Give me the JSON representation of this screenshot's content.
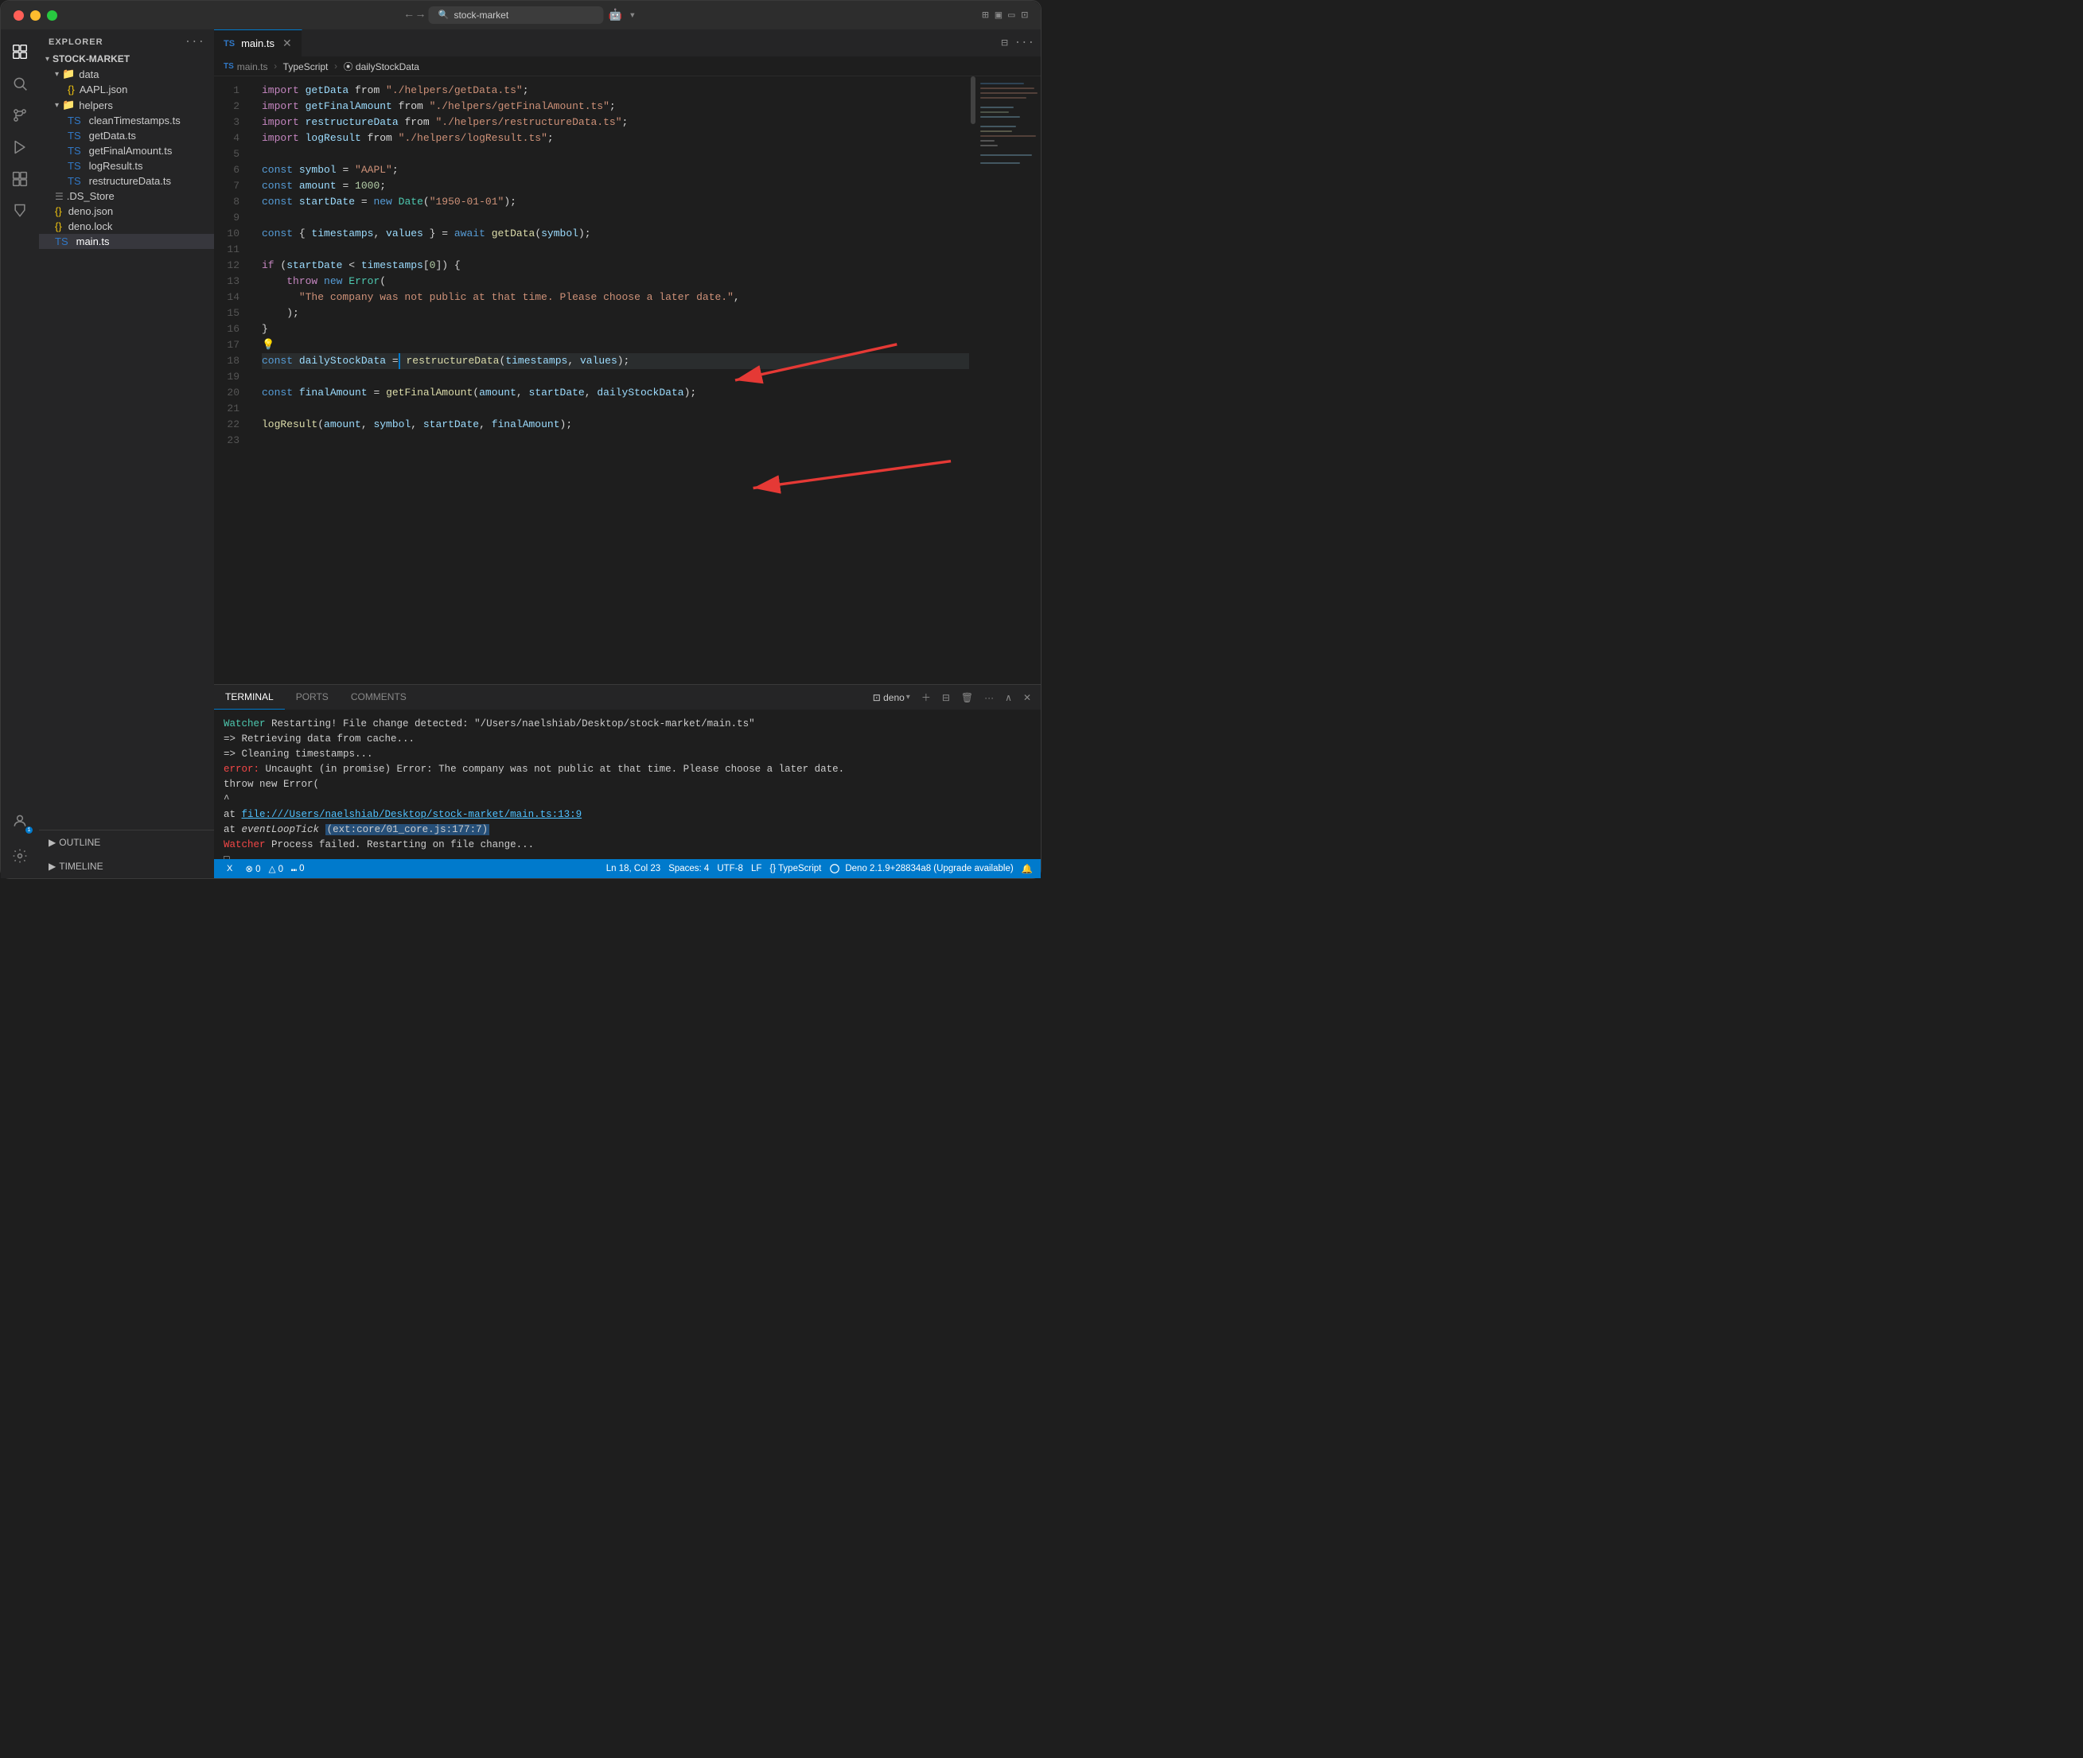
{
  "titlebar": {
    "search_placeholder": "stock-market",
    "nav_back": "←",
    "nav_forward": "→"
  },
  "activity_bar": {
    "items": [
      {
        "name": "explorer",
        "icon": "⧉",
        "active": true
      },
      {
        "name": "search",
        "icon": "🔍"
      },
      {
        "name": "source-control",
        "icon": "⑂"
      },
      {
        "name": "run-debug",
        "icon": "▷"
      },
      {
        "name": "extensions",
        "icon": "⊞"
      },
      {
        "name": "testing",
        "icon": "⚗"
      }
    ]
  },
  "sidebar": {
    "title": "EXPLORER",
    "more_icon": "···",
    "project_name": "STOCK-MARKET",
    "tree": [
      {
        "level": 1,
        "type": "folder",
        "name": "data",
        "expanded": true
      },
      {
        "level": 2,
        "type": "json",
        "name": "AAPL.json"
      },
      {
        "level": 1,
        "type": "folder",
        "name": "helpers",
        "expanded": true
      },
      {
        "level": 2,
        "type": "ts",
        "name": "cleanTimestamps.ts"
      },
      {
        "level": 2,
        "type": "ts",
        "name": "getData.ts"
      },
      {
        "level": 2,
        "type": "ts",
        "name": "getFinalAmount.ts"
      },
      {
        "level": 2,
        "type": "ts",
        "name": "logResult.ts"
      },
      {
        "level": 2,
        "type": "ts",
        "name": "restructureData.ts"
      },
      {
        "level": 1,
        "type": "file",
        "name": ".DS_Store"
      },
      {
        "level": 1,
        "type": "json",
        "name": "deno.json"
      },
      {
        "level": 1,
        "type": "json",
        "name": "deno.lock"
      },
      {
        "level": 1,
        "type": "ts",
        "name": "main.ts",
        "active": true
      }
    ],
    "outline_label": "OUTLINE",
    "timeline_label": "TIMELINE"
  },
  "editor": {
    "tab_label": "main.ts",
    "breadcrumb": [
      "TS main.ts",
      ">",
      "TypeScript",
      ">",
      "⦿ dailyStockData"
    ],
    "lines": [
      {
        "num": 1,
        "tokens": [
          {
            "t": "imp",
            "v": "import"
          },
          {
            "t": "op",
            "v": " "
          },
          {
            "t": "var",
            "v": "getData"
          },
          {
            "t": "op",
            "v": " from "
          },
          {
            "t": "str",
            "v": "\"./helpers/getData.ts\""
          },
          {
            "t": "op",
            "v": ";"
          }
        ]
      },
      {
        "num": 2,
        "tokens": [
          {
            "t": "imp",
            "v": "import"
          },
          {
            "t": "op",
            "v": " "
          },
          {
            "t": "var",
            "v": "getFinalAmount"
          },
          {
            "t": "op",
            "v": " from "
          },
          {
            "t": "str",
            "v": "\"./helpers/getFinalAmount.ts\""
          },
          {
            "t": "op",
            "v": ";"
          }
        ]
      },
      {
        "num": 3,
        "tokens": [
          {
            "t": "imp",
            "v": "import"
          },
          {
            "t": "op",
            "v": " "
          },
          {
            "t": "var",
            "v": "restructureData"
          },
          {
            "t": "op",
            "v": " from "
          },
          {
            "t": "str",
            "v": "\"./helpers/restructureData.ts\""
          },
          {
            "t": "op",
            "v": ";"
          }
        ]
      },
      {
        "num": 4,
        "tokens": [
          {
            "t": "imp",
            "v": "import"
          },
          {
            "t": "op",
            "v": " "
          },
          {
            "t": "var",
            "v": "logResult"
          },
          {
            "t": "op",
            "v": " from "
          },
          {
            "t": "str",
            "v": "\"./helpers/logResult.ts\""
          },
          {
            "t": "op",
            "v": ";"
          }
        ]
      },
      {
        "num": 5,
        "tokens": []
      },
      {
        "num": 6,
        "tokens": [
          {
            "t": "kw",
            "v": "const"
          },
          {
            "t": "op",
            "v": " "
          },
          {
            "t": "var",
            "v": "symbol"
          },
          {
            "t": "op",
            "v": " = "
          },
          {
            "t": "str",
            "v": "\"AAPL\""
          },
          {
            "t": "op",
            "v": ";"
          }
        ]
      },
      {
        "num": 7,
        "tokens": [
          {
            "t": "kw",
            "v": "const"
          },
          {
            "t": "op",
            "v": " "
          },
          {
            "t": "var",
            "v": "amount"
          },
          {
            "t": "op",
            "v": " = "
          },
          {
            "t": "num",
            "v": "1000"
          },
          {
            "t": "op",
            "v": ";"
          }
        ]
      },
      {
        "num": 8,
        "tokens": [
          {
            "t": "kw",
            "v": "const"
          },
          {
            "t": "op",
            "v": " "
          },
          {
            "t": "var",
            "v": "startDate"
          },
          {
            "t": "op",
            "v": " = "
          },
          {
            "t": "kw",
            "v": "new"
          },
          {
            "t": "op",
            "v": " "
          },
          {
            "t": "cls",
            "v": "Date"
          },
          {
            "t": "op",
            "v": "("
          },
          {
            "t": "str",
            "v": "\"1950-01-01\""
          },
          {
            "t": "op",
            "v": "); "
          }
        ]
      },
      {
        "num": 9,
        "tokens": []
      },
      {
        "num": 10,
        "tokens": [
          {
            "t": "kw",
            "v": "const"
          },
          {
            "t": "op",
            "v": " { "
          },
          {
            "t": "var",
            "v": "timestamps"
          },
          {
            "t": "op",
            "v": ", "
          },
          {
            "t": "var",
            "v": "values"
          },
          {
            "t": "op",
            "v": " } = "
          },
          {
            "t": "kw",
            "v": "await"
          },
          {
            "t": "op",
            "v": " "
          },
          {
            "t": "fn",
            "v": "getData"
          },
          {
            "t": "op",
            "v": "("
          },
          {
            "t": "var",
            "v": "symbol"
          },
          {
            "t": "op",
            "v": ");"
          }
        ]
      },
      {
        "num": 11,
        "tokens": []
      },
      {
        "num": 12,
        "tokens": [
          {
            "t": "kw2",
            "v": "if"
          },
          {
            "t": "op",
            "v": " ("
          },
          {
            "t": "var",
            "v": "startDate"
          },
          {
            "t": "op",
            "v": " < "
          },
          {
            "t": "var",
            "v": "timestamps"
          },
          {
            "t": "op",
            "v": "["
          },
          {
            "t": "num",
            "v": "0"
          },
          {
            "t": "op",
            "v": "]) {"
          }
        ]
      },
      {
        "num": 13,
        "tokens": [
          {
            "t": "op",
            "v": "    "
          },
          {
            "t": "kw2",
            "v": "throw"
          },
          {
            "t": "op",
            "v": " "
          },
          {
            "t": "kw",
            "v": "new"
          },
          {
            "t": "op",
            "v": " "
          },
          {
            "t": "cls",
            "v": "Error"
          },
          {
            "t": "op",
            "v": "("
          }
        ]
      },
      {
        "num": 14,
        "tokens": [
          {
            "t": "op",
            "v": "      "
          },
          {
            "t": "str",
            "v": "\"The company was not public at that time. Please choose a later date.\""
          },
          {
            "t": "op",
            "v": ","
          }
        ]
      },
      {
        "num": 15,
        "tokens": [
          {
            "t": "op",
            "v": "    );"
          }
        ]
      },
      {
        "num": 16,
        "tokens": [
          {
            "t": "op",
            "v": "}"
          }
        ]
      },
      {
        "num": 17,
        "tokens": [
          {
            "t": "lightbulb",
            "v": "💡"
          }
        ]
      },
      {
        "num": 18,
        "tokens": [
          {
            "t": "kw",
            "v": "const"
          },
          {
            "t": "op",
            "v": " "
          },
          {
            "t": "var",
            "v": "dailyStockData"
          },
          {
            "t": "op",
            "v": " = "
          },
          {
            "t": "fn",
            "v": "restructureData"
          },
          {
            "t": "op",
            "v": "("
          },
          {
            "t": "var",
            "v": "timestamps"
          },
          {
            "t": "op",
            "v": ", "
          },
          {
            "t": "var",
            "v": "values"
          },
          {
            "t": "op",
            "v": ");"
          }
        ],
        "highlight": true
      },
      {
        "num": 19,
        "tokens": []
      },
      {
        "num": 20,
        "tokens": [
          {
            "t": "kw",
            "v": "const"
          },
          {
            "t": "op",
            "v": " "
          },
          {
            "t": "var",
            "v": "finalAmount"
          },
          {
            "t": "op",
            "v": " = "
          },
          {
            "t": "fn",
            "v": "getFinalAmount"
          },
          {
            "t": "op",
            "v": "("
          },
          {
            "t": "var",
            "v": "amount"
          },
          {
            "t": "op",
            "v": ", "
          },
          {
            "t": "var",
            "v": "startDate"
          },
          {
            "t": "op",
            "v": ", "
          },
          {
            "t": "var",
            "v": "dailyStockData"
          },
          {
            "t": "op",
            "v": ");"
          }
        ]
      },
      {
        "num": 21,
        "tokens": []
      },
      {
        "num": 22,
        "tokens": [
          {
            "t": "fn",
            "v": "logResult"
          },
          {
            "t": "op",
            "v": "("
          },
          {
            "t": "var",
            "v": "amount"
          },
          {
            "t": "op",
            "v": ", "
          },
          {
            "t": "var",
            "v": "symbol"
          },
          {
            "t": "op",
            "v": ", "
          },
          {
            "t": "var",
            "v": "startDate"
          },
          {
            "t": "op",
            "v": ", "
          },
          {
            "t": "var",
            "v": "finalAmount"
          },
          {
            "t": "op",
            "v": ");"
          }
        ]
      },
      {
        "num": 23,
        "tokens": []
      }
    ]
  },
  "terminal": {
    "tabs": [
      "TERMINAL",
      "PORTS",
      "COMMENTS"
    ],
    "active_tab": "TERMINAL",
    "shell_label": "deno",
    "lines": [
      {
        "type": "normal",
        "text": "Watcher Restarting! File change detected: \"/Users/naelshiab/Desktop/stock-market/main.ts\""
      },
      {
        "type": "normal",
        "text": "=> Retrieving data from cache..."
      },
      {
        "type": "normal",
        "text": "=> Cleaning timestamps..."
      },
      {
        "type": "error",
        "text": "error: Uncaught (in promise) Error: The company was not public at that time. Please choose a later date."
      },
      {
        "type": "normal",
        "text": "    throw new Error("
      },
      {
        "type": "normal",
        "text": "          ^"
      },
      {
        "type": "normal",
        "text": "    at ",
        "link": "file:///Users/naelshiab/Desktop/stock-market/main.ts:13:9",
        "link_text": "file:///Users/naelshiab/Desktop/stock-market/main.ts:13:9"
      },
      {
        "type": "normal",
        "text": "    at ",
        "italic": "eventLoopTick",
        "rest": " (ext:core/01_core.js:177:7)",
        "highlight": "(ext:core/01_core.js:177:7)"
      },
      {
        "type": "error",
        "text": "Watcher Process failed. Restarting on file change..."
      },
      {
        "type": "normal",
        "text": "□"
      }
    ]
  },
  "status_bar": {
    "x_label": "X",
    "ln_col": "Ln 18, Col 23",
    "spaces": "Spaces: 4",
    "encoding": "UTF-8",
    "line_ending": "LF",
    "language": "{} TypeScript",
    "runtime": "Deno 2.1.9+28834a8 (Upgrade available)",
    "errors": "⊗ 0",
    "warnings": "△ 0",
    "info": "⑉ 0"
  }
}
